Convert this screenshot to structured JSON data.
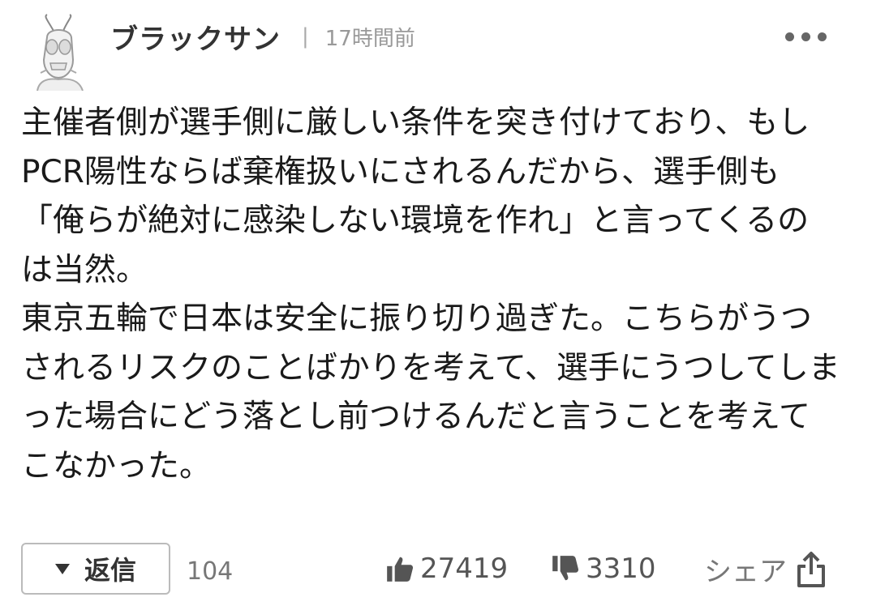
{
  "comment": {
    "username": "ブラックサン",
    "separator": "|",
    "timestamp": "17時間前",
    "body": [
      "主催者側が選手側に厳しい条件を突き付けており、もしPCR陽性ならば棄権扱いにされるんだから、選手側も「俺らが絶対に感染しない環境を作れ」と言ってくるのは当然。",
      "東京五輪で日本は安全に振り切り過ぎた。こちらがうつされるリスクのことばかりを考えて、選手にうつしてしまった場合にどう落とし前つけるんだと言うことを考えてこなかった。"
    ],
    "reply_label": "返信",
    "reply_count": "104",
    "like_count": "27419",
    "dislike_count": "3310",
    "share_label": "シェア"
  },
  "icons": {
    "avatar": "avatar-icon",
    "more": "more-options-icon",
    "reply_toggle": "triangle-down-icon",
    "like": "thumbs-up-icon",
    "dislike": "thumbs-down-icon",
    "share": "share-icon"
  }
}
